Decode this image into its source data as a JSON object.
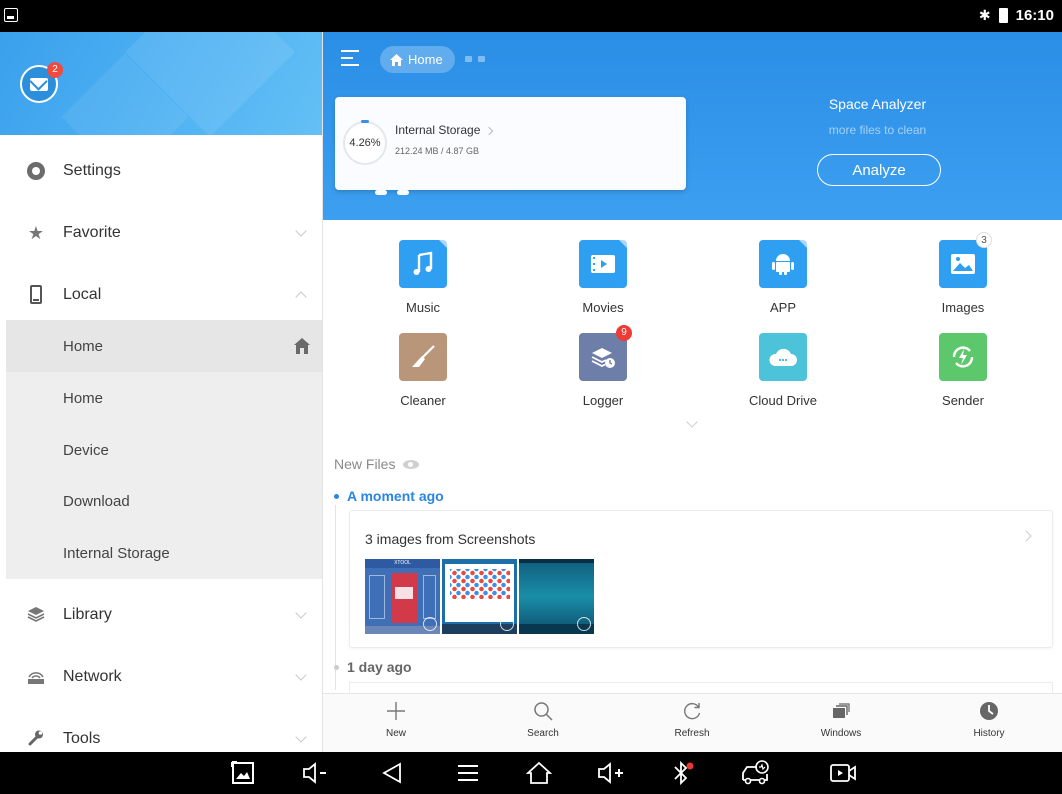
{
  "status_bar": {
    "time": "16:10",
    "bluetooth_icon": "bluetooth-icon",
    "battery_icon": "battery-icon"
  },
  "sidebar": {
    "mail_badge": "2",
    "items": [
      {
        "label": "Settings",
        "icon": "gear-icon"
      },
      {
        "label": "Favorite",
        "icon": "star-icon"
      },
      {
        "label": "Local",
        "icon": "phone-icon"
      },
      {
        "label": "Library",
        "icon": "layers-icon"
      },
      {
        "label": "Network",
        "icon": "network-icon"
      },
      {
        "label": "Tools",
        "icon": "wrench-icon"
      }
    ],
    "local_children": [
      "Home",
      "Home",
      "Device",
      "Download",
      "Internal Storage"
    ]
  },
  "header": {
    "breadcrumb": "Home",
    "storage": {
      "percent": "4.26%",
      "name": "Internal Storage",
      "size": "212.24 MB / 4.87 GB"
    },
    "analyzer": {
      "title": "Space Analyzer",
      "subtitle": "more files to clean",
      "button": "Analyze"
    }
  },
  "categories": [
    {
      "name": "Music",
      "color": "#2f9ff2",
      "icon": "music-note-icon",
      "badge": ""
    },
    {
      "name": "Movies",
      "color": "#2f9ff2",
      "icon": "film-icon",
      "badge": ""
    },
    {
      "name": "APP",
      "color": "#2f9ff2",
      "icon": "android-icon",
      "badge": ""
    },
    {
      "name": "Images",
      "color": "#2f9ff2",
      "icon": "image-icon",
      "badge": "3"
    },
    {
      "name": "Cleaner",
      "color": "#b9967a",
      "icon": "broom-icon",
      "badge": ""
    },
    {
      "name": "Logger",
      "color": "#6d7fa8",
      "icon": "logger-icon",
      "badge": "9"
    },
    {
      "name": "Cloud Drive",
      "color": "#4cc3d9",
      "icon": "cloud-icon",
      "badge": ""
    },
    {
      "name": "Sender",
      "color": "#5dc86b",
      "icon": "sender-icon",
      "badge": ""
    }
  ],
  "new_files": {
    "label": "New Files",
    "groups": [
      {
        "time": "A moment ago",
        "card_title": "3 images from Screenshots"
      },
      {
        "time": "1 day ago"
      }
    ],
    "thumb_caption": "XTOOL"
  },
  "toolbar": [
    {
      "label": "New",
      "icon": "plus-icon"
    },
    {
      "label": "Search",
      "icon": "search-icon"
    },
    {
      "label": "Refresh",
      "icon": "refresh-icon"
    },
    {
      "label": "Windows",
      "icon": "windows-icon"
    },
    {
      "label": "History",
      "icon": "history-icon"
    }
  ],
  "nav_bar": [
    "screenshot-icon",
    "volume-down-icon",
    "back-icon",
    "menu-icon",
    "home-icon",
    "volume-up-icon",
    "bluetooth-icon",
    "car-diagnostic-icon",
    "screen-record-icon"
  ]
}
